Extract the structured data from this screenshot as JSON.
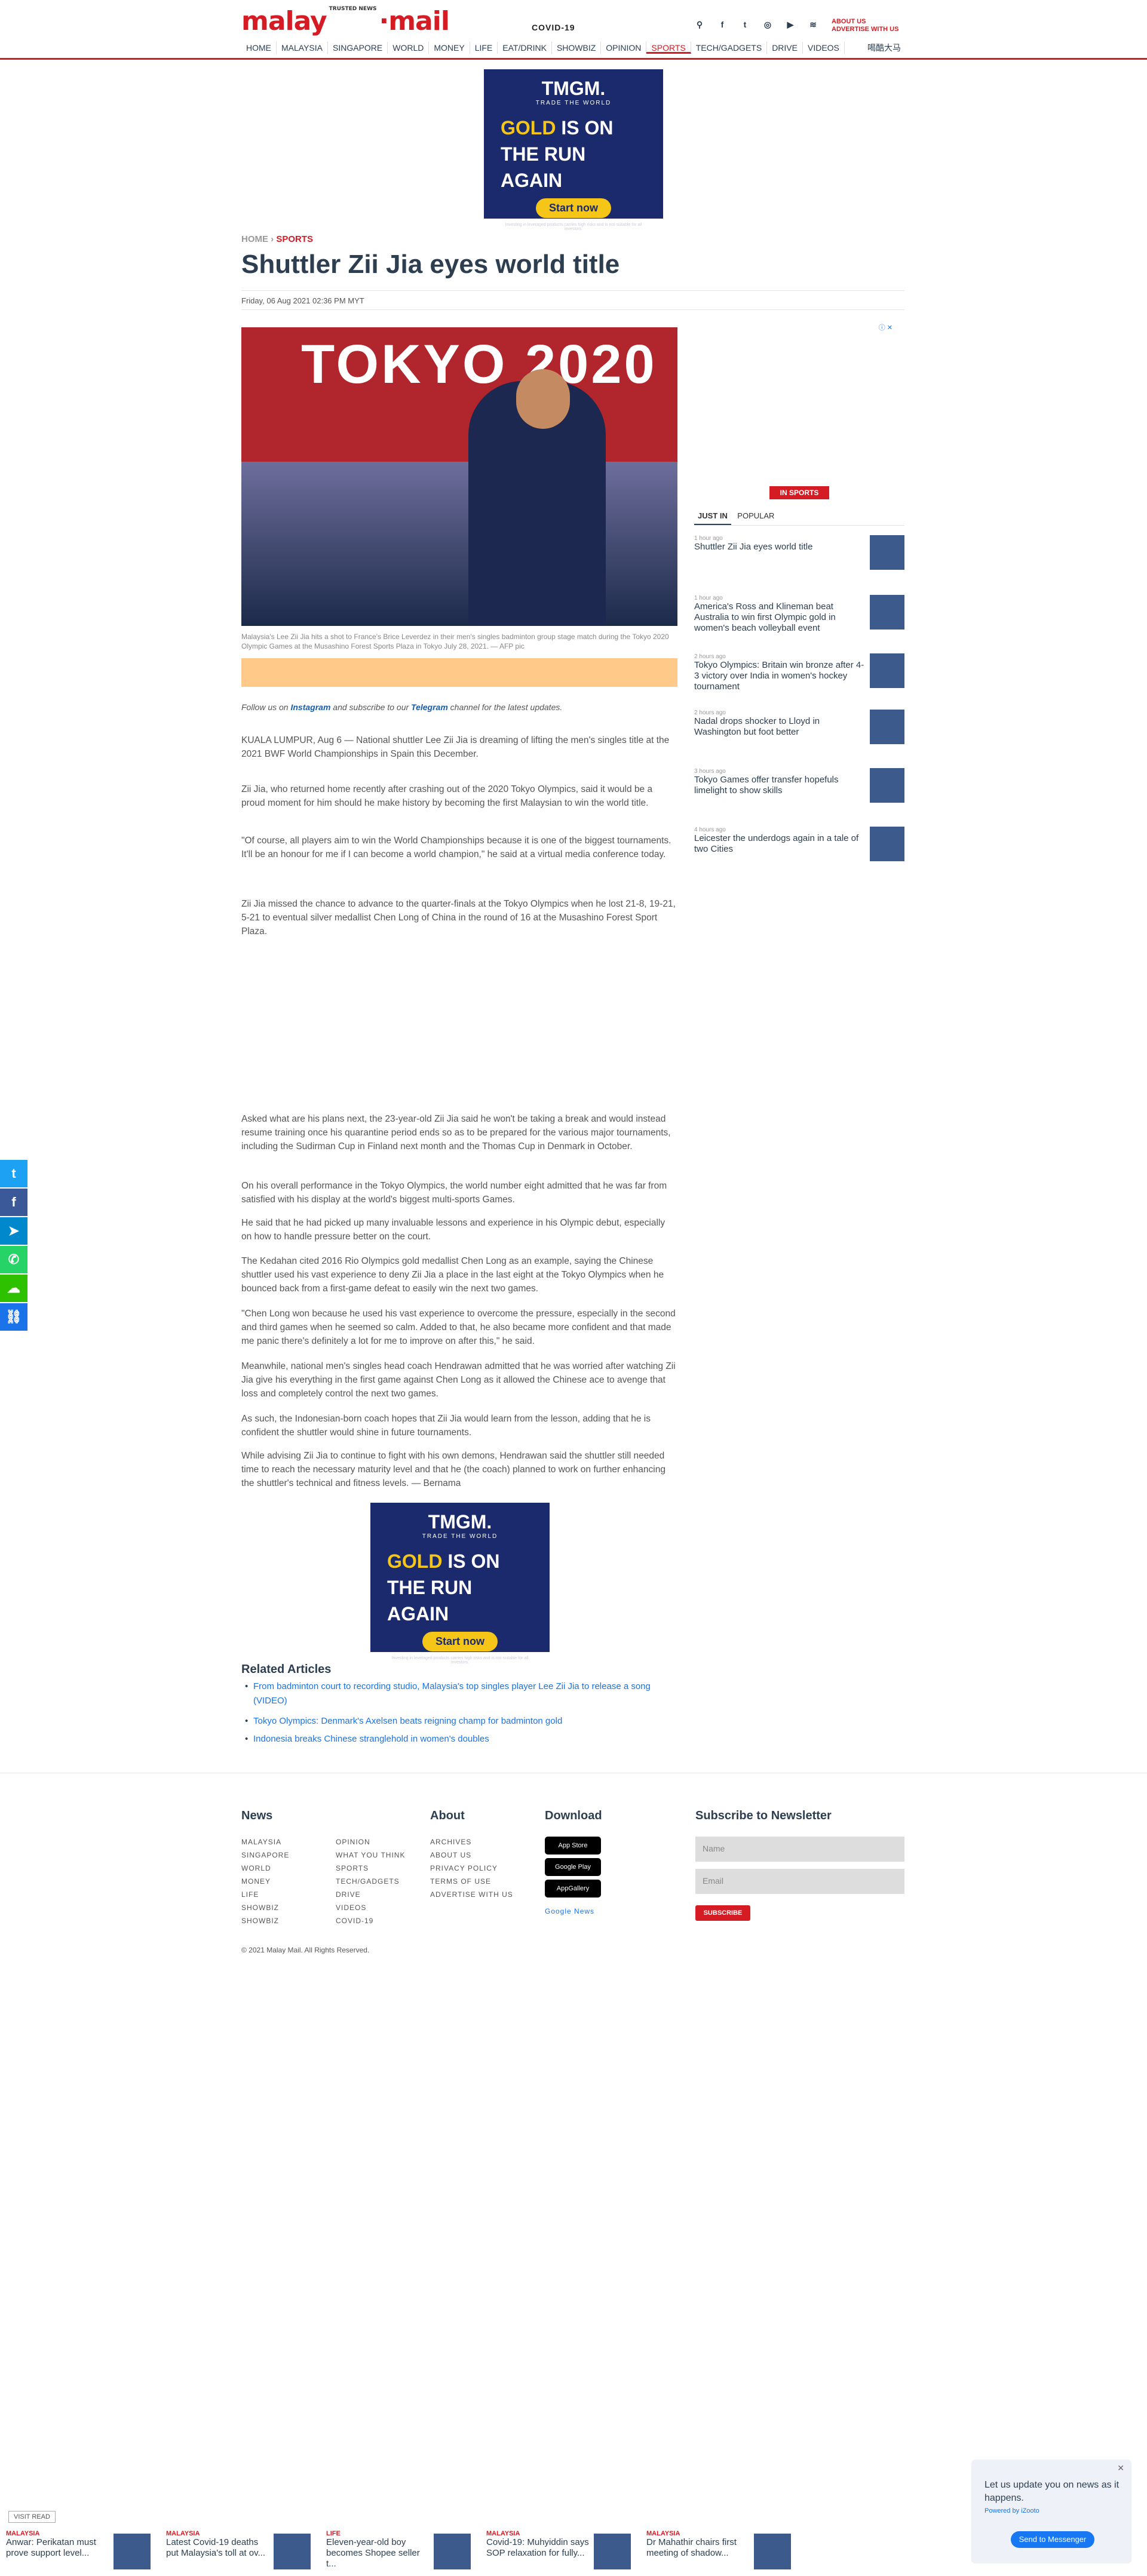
{
  "header": {
    "logo": "malay",
    "logo_small": "TRUSTED NEWS",
    "logo_tail": "mail",
    "covid": "COVID-19",
    "about": "ABOUT US",
    "advertise": "ADVERTISE WITH US",
    "nav": [
      "HOME",
      "MALAYSIA",
      "SINGAPORE",
      "WORLD",
      "MONEY",
      "LIFE",
      "EAT/DRINK",
      "SHOWBIZ",
      "OPINION",
      "SPORTS",
      "TECH/GADGETS",
      "DRIVE",
      "VIDEOS"
    ],
    "nav_jp": "喝酷大马"
  },
  "ad": {
    "brand": "TMGM.",
    "tagline": "TRADE THE WORLD",
    "slogan_gold": "GOLD",
    "slogan_rest": " IS ON",
    "slogan2": "THE RUN",
    "slogan3": "AGAIN",
    "cta": "Start now",
    "fine": "Investing in leveraged products carries high risks and is not suitable for all investors."
  },
  "article": {
    "crumb_home": "HOME",
    "crumb_sep": " › ",
    "crumb_section": "SPORTS",
    "title": "Shuttler Zii Jia eyes world title",
    "date": "Friday, 06 Aug 2021 02:36 PM MYT",
    "hero_text": "TOKYO 2020",
    "caption": "Malaysia's Lee Zii Jia hits a shot to France's Brice Leverdez in their men's singles badminton group stage match during the Tokyo 2020 Olympic Games at the Musashino Forest Sports Plaza in Tokyo July 28, 2021. — AFP pic",
    "follow_pre": "Follow us on ",
    "follow_ig": "Instagram",
    "follow_mid": " and subscribe to our ",
    "follow_tg": "Telegram",
    "follow_post": " channel for the latest updates.",
    "paragraphs": [
      "KUALA LUMPUR, Aug 6 — National shuttler Lee Zii Jia is dreaming of lifting the men's singles title at the 2021 BWF World Championships in Spain this December.",
      "Zii Jia, who returned home recently after crashing out of the 2020 Tokyo Olympics, said it would be a proud moment for him should he make history by becoming the first Malaysian to win the world title.",
      "\"Of course, all players aim to win the World Championships because it is one of the biggest tournaments. It'll be an honour for me if I can become a world champion,\" he said at a virtual media conference today.",
      "Zii Jia missed the chance to advance to the quarter-finals at the Tokyo Olympics when he lost 21-8, 19-21, 5-21 to eventual silver medallist Chen Long of China in the round of 16 at the Musashino Forest Sport Plaza.",
      "Asked what are his plans next, the 23-year-old Zii Jia said he won't be taking a break and would instead resume training once his quarantine period ends so as to be prepared for the various major tournaments, including the Sudirman Cup in Finland next month and the Thomas Cup in Denmark in October.",
      "On his overall performance in the Tokyo Olympics, the world number eight admitted that he was far from satisfied with his display at the world's biggest multi-sports Games.",
      "He said that he had picked up many invaluable lessons and experience in his Olympic debut, especially on how to handle pressure better on the court.",
      "The Kedahan cited 2016 Rio Olympics gold medallist Chen Long as an example, saying the Chinese shuttler used his vast experience to deny Zii Jia a place in the last eight at the Tokyo Olympics when he bounced back from a first-game defeat to easily win the next two games.",
      "\"Chen Long won because he used his vast experience to overcome the pressure, especially in the second and third games when he seemed so calm. Added to that, he also became more confident and that made me panic there's definitely a lot for me to improve on after this,\" he said.",
      "Meanwhile, national men's singles head coach Hendrawan admitted that he was worried after watching Zii Jia give his everything in the first game against Chen Long as it allowed the Chinese ace to avenge that loss and completely control the next two games.",
      "As such, the Indonesian-born coach hopes that Zii Jia would learn from the lesson, adding that he is confident the shuttler would shine in future tournaments.",
      "While advising Zii Jia to continue to fight with his own demons, Hendrawan said the shuttler still needed time to reach the necessary maturity level and that he (the coach) planned to work on further enhancing the shuttler's technical and fitness levels. — Bernama"
    ],
    "related_title": "Related Articles",
    "related": [
      "From badminton court to recording studio, Malaysia's top singles player Lee Zii Jia to release a song (VIDEO)",
      "Tokyo Olympics: Denmark's Axelsen beats reigning champ for badminton gold",
      "Indonesia breaks Chinese stranglehold in women's doubles"
    ]
  },
  "sidebar": {
    "ad_label": "ⓘ ✕",
    "badge": "IN SPORTS",
    "tab_just_in": "JUST IN",
    "tab_popular": "POPULAR",
    "items": [
      {
        "time": "1 hour ago",
        "headline": "Shuttler Zii Jia eyes world title"
      },
      {
        "time": "1 hour ago",
        "headline": "America's Ross and Klineman beat Australia to win first Olympic gold in women's beach volleyball event"
      },
      {
        "time": "2 hours ago",
        "headline": "Tokyo Olympics: Britain win bronze after 4-3 victory over India in women's hockey tournament"
      },
      {
        "time": "2 hours ago",
        "headline": "Nadal drops shocker to Lloyd in Washington but foot better"
      },
      {
        "time": "3 hours ago",
        "headline": "Tokyo Games offer transfer hopefuls limelight to show skills"
      },
      {
        "time": "4 hours ago",
        "headline": "Leicester the underdogs again in a tale of two Cities"
      }
    ]
  },
  "footer": {
    "news_heading": "News",
    "about_heading": "About",
    "download_heading": "Download",
    "newsletter_heading": "Subscribe to Newsletter",
    "news_col1": [
      "MALAYSIA",
      "SINGAPORE",
      "WORLD",
      "MONEY",
      "LIFE",
      "SHOWBIZ",
      "SHOWBIZ"
    ],
    "news_col2": [
      "OPINION",
      "WHAT YOU THINK",
      "SPORTS",
      "TECH/GADGETS",
      "DRIVE",
      "VIDEOS",
      "COVID-19"
    ],
    "about_links": [
      "ARCHIVES",
      "ABOUT US",
      "PRIVACY POLICY",
      "TERMS OF USE",
      "ADVERTISE WITH US"
    ],
    "stores": [
      "App Store",
      "Google Play",
      "AppGallery"
    ],
    "google_news": "Google News",
    "name_placeholder": "Name",
    "email_placeholder": "Email",
    "subscribe": "SUBSCRIBE",
    "copyright": "© 2021 Malay Mail. All Rights Reserved."
  },
  "bottom_strip": {
    "visit": "VISIT READ",
    "items": [
      {
        "cat": "MALAYSIA",
        "headline": "Anwar: Perikatan must prove support level..."
      },
      {
        "cat": "MALAYSIA",
        "headline": "Latest Covid-19 deaths put Malaysia's toll at ov..."
      },
      {
        "cat": "LIFE",
        "headline": "Eleven-year-old boy becomes Shopee seller t..."
      },
      {
        "cat": "MALAYSIA",
        "headline": "Covid-19: Muhyiddin says SOP relaxation for fully..."
      },
      {
        "cat": "MALAYSIA",
        "headline": "Dr Mahathir chairs first meeting of shadow..."
      }
    ]
  },
  "messenger": {
    "message": "Let us update you on news as it happens.",
    "powered": "Powered by iZooto",
    "button": "Send to Messenger"
  }
}
